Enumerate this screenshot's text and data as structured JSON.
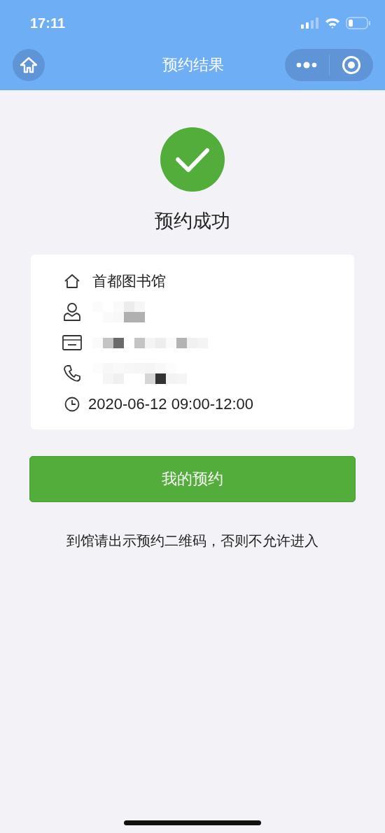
{
  "status_bar": {
    "time": "17:11"
  },
  "nav": {
    "title": "预约结果"
  },
  "result": {
    "kind": "success",
    "title": "预约成功"
  },
  "details": [
    {
      "kind": "library",
      "redacted": false,
      "text": "首都图书馆"
    },
    {
      "kind": "person",
      "redacted": true
    },
    {
      "kind": "card",
      "redacted": true
    },
    {
      "kind": "phone",
      "redacted": true
    },
    {
      "kind": "time",
      "redacted": false,
      "text": "2020-06-12 09:00-12:00"
    }
  ],
  "button": {
    "label": "我的预约"
  },
  "notice": "到馆请出示预约二维码，否则不允许进入"
}
